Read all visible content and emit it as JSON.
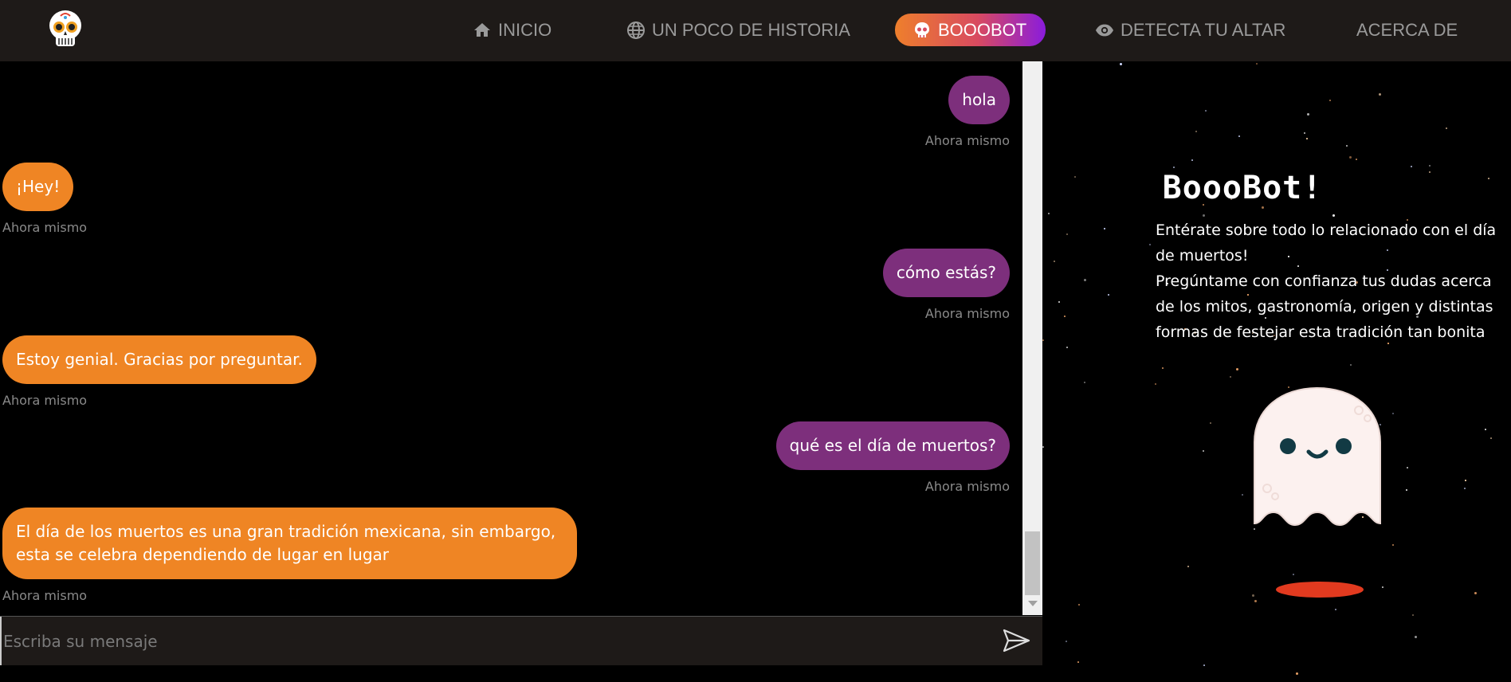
{
  "nav": {
    "items": [
      {
        "label": "INICIO",
        "icon": "home-icon"
      },
      {
        "label": "UN POCO DE HISTORIA",
        "icon": "globe-icon"
      },
      {
        "label": "BOOOBOT",
        "icon": "skull-icon",
        "active": true
      },
      {
        "label": "DETECTA TU ALTAR",
        "icon": "eye-icon"
      },
      {
        "label": "ACERCA DE",
        "icon": ""
      }
    ],
    "logo": "sugar-skull-logo"
  },
  "chat": {
    "messages": [
      {
        "sender": "user",
        "text": "hola",
        "time": "Ahora mismo"
      },
      {
        "sender": "bot",
        "text": "¡Hey!",
        "time": "Ahora mismo"
      },
      {
        "sender": "user",
        "text": "cómo estás?",
        "time": "Ahora mismo"
      },
      {
        "sender": "bot",
        "text": "Estoy genial. Gracias por preguntar.",
        "time": "Ahora mismo"
      },
      {
        "sender": "user",
        "text": "qué es el día de muertos?",
        "time": "Ahora mismo"
      },
      {
        "sender": "bot",
        "text": "El día de los muertos es una gran tradición mexicana, sin embargo, esta se celebra dependiendo de lugar en lugar",
        "time": "Ahora mismo"
      }
    ],
    "input_placeholder": "Escriba su mensaje"
  },
  "sidebar": {
    "title": "BoooBot!",
    "intro": "Entérate sobre todo lo relacionado con el día de muertos!",
    "prompt": "Pregúntame con confianza tus dudas acerca de los mitos, gastronomía, origen y distintas formas de festejar esta tradición tan bonita"
  },
  "colors": {
    "user_bubble": "#7d2f7c",
    "bot_bubble": "#ef8524",
    "navbar": "#1e1a18",
    "active_gradient_start": "#ee7f2c",
    "active_gradient_end": "#8a1cdc"
  }
}
